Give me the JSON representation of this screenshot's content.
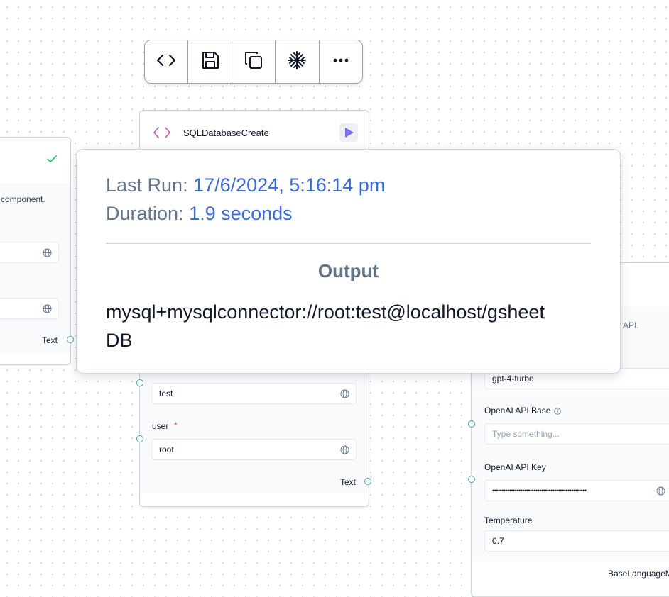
{
  "toolbar": {
    "items": [
      {
        "icon": "code-icon"
      },
      {
        "icon": "save-icon"
      },
      {
        "icon": "duplicate-icon"
      },
      {
        "icon": "freeze-icon"
      },
      {
        "icon": "more-icon"
      }
    ]
  },
  "left_node": {
    "description": "component.",
    "output_label": "Text",
    "status_color": "#22c55e"
  },
  "sql_node": {
    "title": "SQLDatabaseCreate",
    "password_value": "test",
    "user_label": "user",
    "user_required": "*",
    "user_value": "root",
    "output_label": "Text"
  },
  "right_node": {
    "description": "els API.",
    "model_value": "gpt-4-turbo",
    "api_base_label": "OpenAI API Base",
    "api_base_placeholder": "Type something...",
    "api_key_label": "OpenAI API Key",
    "api_key_value": "••••••••••••••••••••••••••••••••••••••••••••••••••",
    "temperature_label": "Temperature",
    "temperature_value": "0.7",
    "output_label": "BaseLanguageM"
  },
  "popover": {
    "last_run_label": "Last Run:",
    "last_run_value": "17/6/2024, 5:16:14 pm",
    "duration_label": "Duration:",
    "duration_value": "1.9 seconds",
    "output_heading": "Output",
    "output_value": "mysql+mysqlconnector://root:test@localhost/gsheetDB"
  },
  "colors": {
    "accent": "#3b6bd6",
    "run_button": "#7c6cf0",
    "handle": "#4d9bb3"
  }
}
